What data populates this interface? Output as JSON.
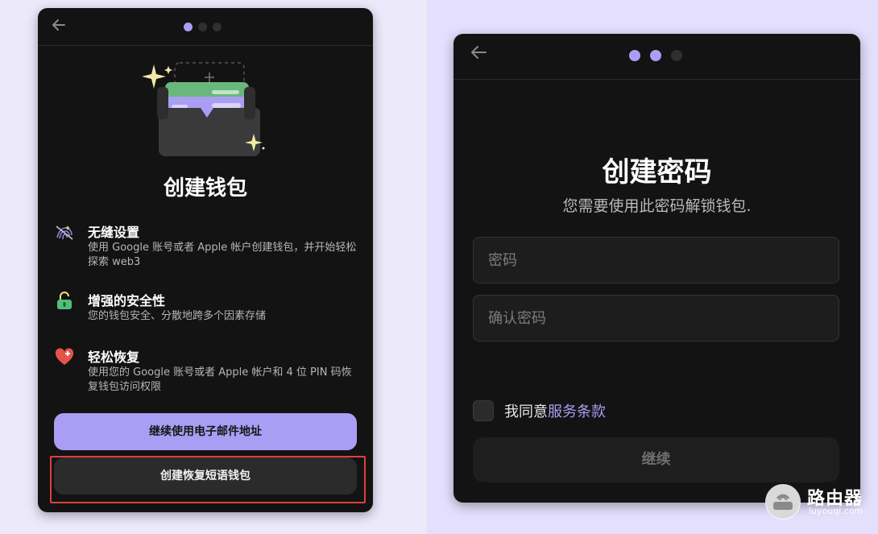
{
  "left_card": {
    "step_dots": [
      true,
      false,
      false
    ],
    "title": "创建钱包",
    "features": [
      {
        "icon": "fingerprint-icon",
        "heading": "无缝设置",
        "description": "使用 Google 账号或者 Apple 帐户创建钱包，并开始轻松探索 web3"
      },
      {
        "icon": "lock-icon",
        "heading": "增强的安全性",
        "description": "您的钱包安全、分散地跨多个因素存储"
      },
      {
        "icon": "heart-icon",
        "heading": "轻松恢复",
        "description": "使用您的 Google 账号或者 Apple 帐户和 4 位 PIN 码恢复钱包访问权限"
      }
    ],
    "primary_button": "继续使用电子邮件地址",
    "secondary_button": "创建恢复短语钱包"
  },
  "right_card": {
    "step_dots": [
      true,
      true,
      false
    ],
    "title": "创建密码",
    "subtitle": "您需要使用此密码解锁钱包.",
    "password_placeholder": "密码",
    "confirm_placeholder": "确认密码",
    "agree_prefix": "我同意",
    "terms_link": "服务条款",
    "continue_button": "继续"
  },
  "watermark": {
    "name": "路由器",
    "url": "luyouqi.com"
  },
  "colors": {
    "accent": "#a99ef3",
    "card_bg": "#131313",
    "page_bg": "#e3dffc",
    "highlight": "#e0403e"
  }
}
